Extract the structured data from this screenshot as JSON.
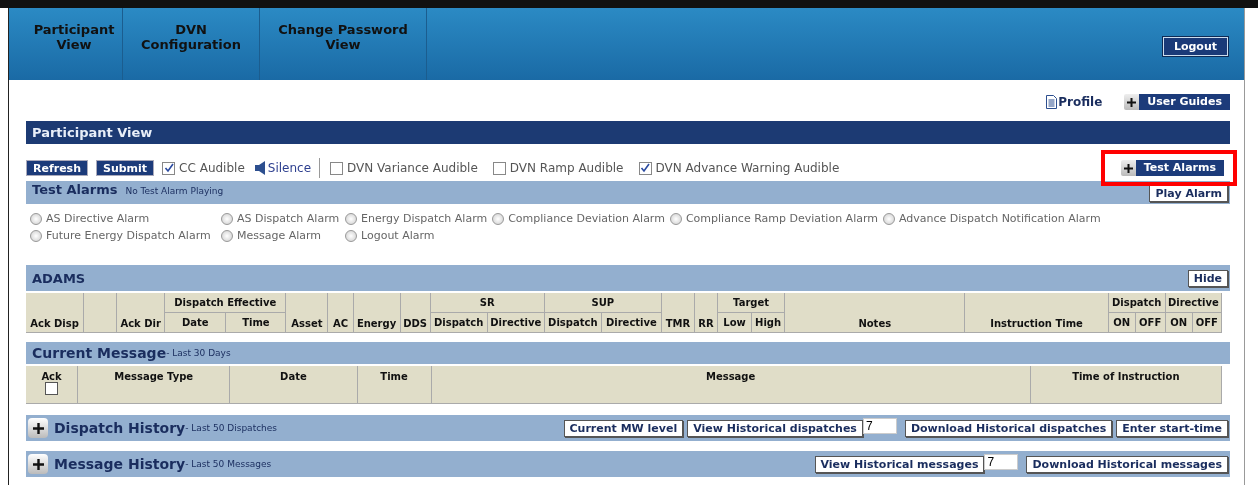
{
  "nav": {
    "tabs": [
      {
        "label": "Participant View"
      },
      {
        "label": "DVN Configuration"
      },
      {
        "label": "Change Password View"
      }
    ],
    "logout": "Logout"
  },
  "links": {
    "profile": "Profile",
    "user_guides": "User Guides"
  },
  "panel": {
    "title": "Participant View"
  },
  "toolbar": {
    "buttons": [
      "Refresh",
      "Submit"
    ],
    "silence": "Silence",
    "checkboxes": [
      {
        "label": "CC Audible",
        "checked": true
      },
      {
        "label": "DVN Variance Audible",
        "checked": false
      },
      {
        "label": "DVN Ramp Audible",
        "checked": false
      },
      {
        "label": "DVN Advance Warning Audible",
        "checked": true
      }
    ],
    "test_alarms_button": "Test Alarms",
    "highlighted": true
  },
  "test_alarms": {
    "title": "Test Alarms",
    "status": "No Test Alarm Playing",
    "play_button": "Play Alarm",
    "options": [
      {
        "label": "AS Directive Alarm",
        "selected": false
      },
      {
        "label": "AS Dispatch Alarm",
        "selected": false
      },
      {
        "label": "Energy Dispatch Alarm",
        "selected": false
      },
      {
        "label": "Compliance Deviation Alarm",
        "selected": false
      },
      {
        "label": "Compliance Ramp Deviation Alarm",
        "selected": false
      },
      {
        "label": "Advance Dispatch Notification Alarm",
        "selected": false
      },
      {
        "label": "Future Energy Dispatch Alarm",
        "selected": false
      },
      {
        "label": "Message Alarm",
        "selected": false
      },
      {
        "label": "Logout Alarm",
        "selected": false
      }
    ]
  },
  "adams": {
    "title": "ADAMS",
    "hide_button": "Hide",
    "columns": [
      {
        "label": "Ack Disp"
      },
      {},
      {
        "label": "Ack Dir"
      },
      {
        "label": "Dispatch Effective",
        "children": [
          "Date",
          "Time"
        ]
      },
      {
        "label": "Asset"
      },
      {
        "label": "AC"
      },
      {
        "label": "Energy"
      },
      {
        "label": "DDS"
      },
      {
        "label": "SR",
        "children": [
          "Dispatch",
          "Directive"
        ]
      },
      {
        "label": "SUP",
        "children": [
          "Dispatch",
          "Directive"
        ]
      },
      {
        "label": "TMR"
      },
      {
        "label": "RR"
      },
      {
        "label": "Target",
        "children": [
          "Low",
          "High"
        ]
      },
      {
        "label": "Notes"
      },
      {
        "label": "Instruction Time"
      },
      {
        "label": "Dispatch",
        "children": [
          "ON",
          "OFF"
        ]
      },
      {
        "label": "Directive",
        "children": [
          "ON",
          "OFF"
        ]
      }
    ]
  },
  "current_message": {
    "title": "Current Message",
    "subtitle": "- Last 30 Days",
    "columns": [
      "Ack",
      "Message Type",
      "Date",
      "Time",
      "Message",
      "Time of Instruction"
    ],
    "ack_checked": false
  },
  "dispatch_history": {
    "title": "Dispatch History",
    "subtitle": "- Last 50 Dispatches",
    "buttons": [
      {
        "kind": "button",
        "label": "Current MW level"
      },
      {
        "kind": "button",
        "label": "View Historical dispatches"
      },
      {
        "kind": "input",
        "value": "7"
      },
      {
        "kind": "button",
        "label": "Download Historical dispatches"
      },
      {
        "kind": "button",
        "label": "Enter start-time"
      }
    ]
  },
  "message_history": {
    "title": "Message History",
    "subtitle": "- Last 50 Messages",
    "buttons": [
      {
        "kind": "button",
        "label": "View Historical messages"
      },
      {
        "kind": "input",
        "value": "7"
      },
      {
        "kind": "button",
        "label": "Download Historical messages"
      }
    ]
  }
}
